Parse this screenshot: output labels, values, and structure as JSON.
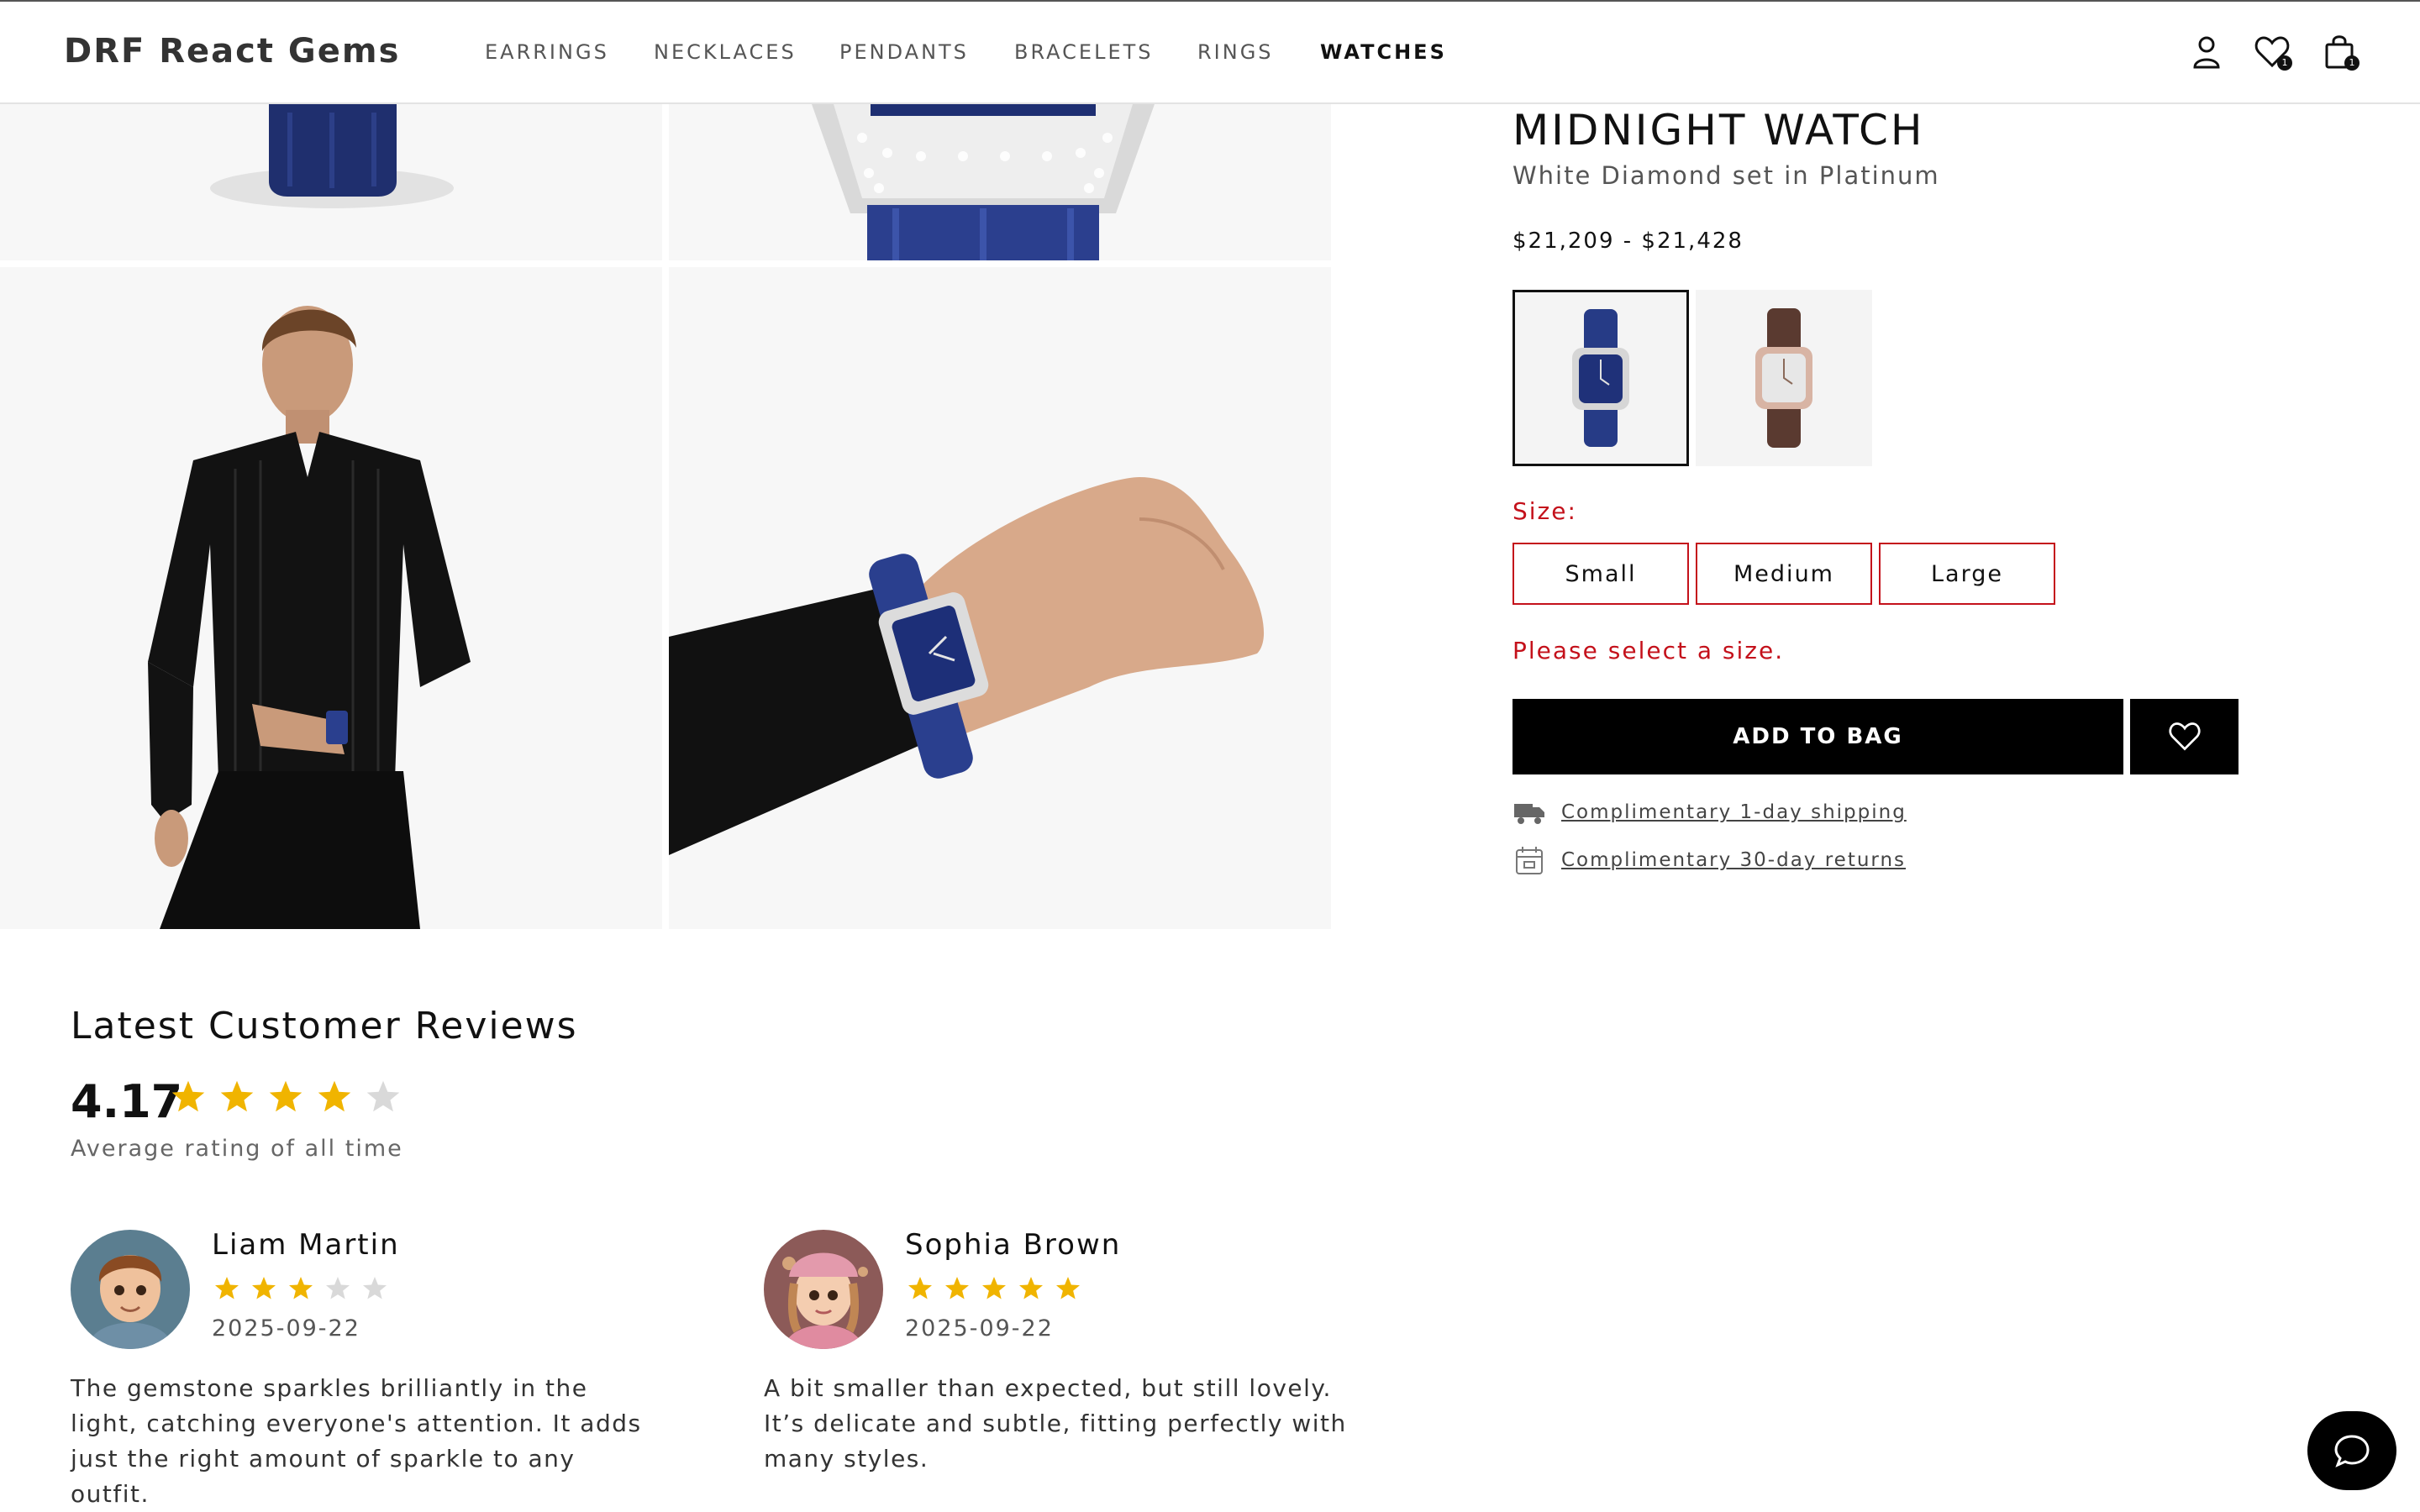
{
  "header": {
    "brand": "DRF React Gems",
    "nav": [
      {
        "label": "EARRINGS",
        "active": false
      },
      {
        "label": "NECKLACES",
        "active": false
      },
      {
        "label": "PENDANTS",
        "active": false
      },
      {
        "label": "BRACELETS",
        "active": false
      },
      {
        "label": "RINGS",
        "active": false
      },
      {
        "label": "WATCHES",
        "active": true
      }
    ],
    "icons": {
      "account": "user-icon",
      "wishlist": "heart-icon",
      "bag": "shopping-bag-icon"
    },
    "wishlist_count": "1",
    "bag_count": "1"
  },
  "product": {
    "title": "MIDNIGHT WATCH",
    "subtitle": "White Diamond set in Platinum",
    "price": "$21,209 - $21,428",
    "swatches": [
      {
        "icon": "blue-watch-thumbnail",
        "selected": true
      },
      {
        "icon": "rose-gold-watch-thumbnail",
        "selected": false
      }
    ],
    "size_label": "Size:",
    "sizes": [
      "Small",
      "Medium",
      "Large"
    ],
    "size_error": "Please select a size.",
    "add_to_bag": "ADD TO BAG",
    "perks": [
      {
        "icon": "truck-icon",
        "text": "Complimentary 1-day shipping"
      },
      {
        "icon": "calendar-icon",
        "text": "Complimentary 30-day returns"
      }
    ]
  },
  "reviews": {
    "title": "Latest Customer Reviews",
    "average": "4.17",
    "average_stars": 4,
    "caption": "Average rating of all time",
    "items": [
      {
        "name": "Liam Martin",
        "stars": 3,
        "date": "2025-09-22",
        "text": "The gemstone sparkles brilliantly in the light, catching everyone's attention. It adds just the right amount of sparkle to any outfit."
      },
      {
        "name": "Sophia Brown",
        "stars": 5,
        "date": "2025-09-22",
        "text": "A bit smaller than expected, but still lovely. It’s delicate and subtle, fitting perfectly with many styles."
      }
    ]
  },
  "colors": {
    "accent_error": "#c4111b",
    "star_filled": "#f0b400",
    "star_empty": "#d9d9d9",
    "primary_button": "#000000"
  }
}
